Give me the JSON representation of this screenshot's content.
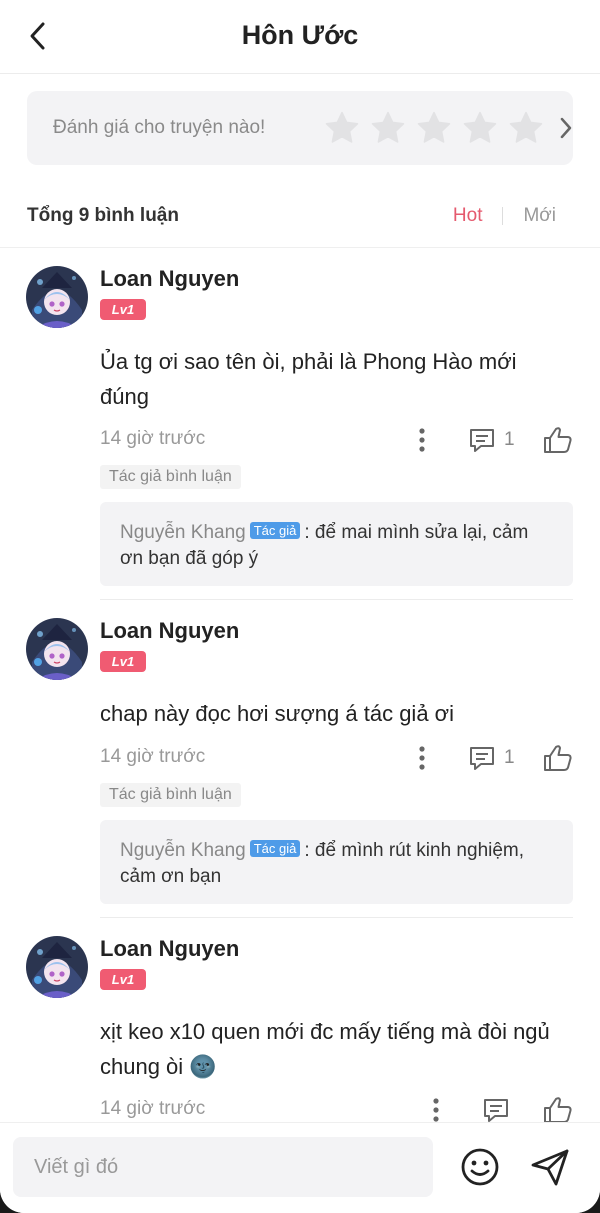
{
  "header": {
    "title": "Hôn Ước"
  },
  "rating": {
    "prompt": "Đánh giá cho truyện nào!"
  },
  "summary": {
    "total": "Tổng 9 bình luận",
    "sort_hot": "Hot",
    "sort_new": "Mới"
  },
  "comments": [
    {
      "username": "Loan Nguyen",
      "level": "Lv1",
      "content": "Ủa tg ơi sao tên òi, phải là Phong Hào mới đúng",
      "time": "14 giờ trước",
      "reply_count": "1",
      "author_tag": "Tác giả bình luận",
      "reply": {
        "author": "Nguyễn Khang",
        "badge": "Tác giả",
        "text": ": để mai mình sửa lại, cảm ơn bạn đã góp ý"
      }
    },
    {
      "username": "Loan Nguyen",
      "level": "Lv1",
      "content": "chap này đọc hơi sượng á tác giả ơi",
      "time": "14 giờ trước",
      "reply_count": "1",
      "author_tag": "Tác giả bình luận",
      "reply": {
        "author": "Nguyễn Khang",
        "badge": "Tác giả",
        "text": ": để mình rút kinh nghiệm, cảm ơn bạn"
      }
    },
    {
      "username": "Loan Nguyen",
      "level": "Lv1",
      "content": "xịt keo x10 quen mới đc mấy tiếng mà đòi ngủ chung òi 🌚",
      "time": "14 giờ trước"
    }
  ],
  "input": {
    "placeholder": "Viết gì đó"
  },
  "colors": {
    "accent": "#e55a6e",
    "level_badge": "#f05b72",
    "author_badge": "#4e9be8"
  },
  "icons": [
    "back-arrow-icon",
    "star-icon",
    "chevron-right-icon",
    "more-vertical-icon",
    "comment-icon",
    "thumbs-up-icon",
    "emoji-icon",
    "send-icon"
  ]
}
